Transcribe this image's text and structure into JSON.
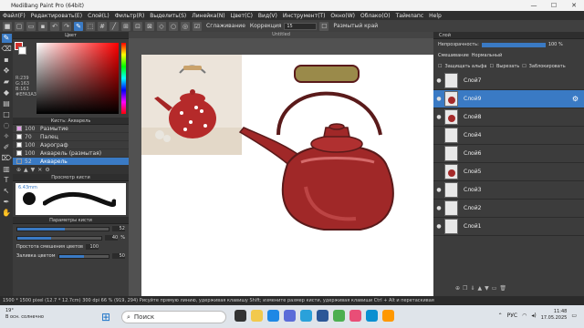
{
  "app": {
    "title": "MediBang Paint Pro (64bit)",
    "doc_title": "Untitled"
  },
  "window": {
    "minimize": "—",
    "maximize": "☐",
    "close": "✕"
  },
  "menu": [
    "Файл(F)",
    "Редактировать(E)",
    "Слой(L)",
    "Фильтр(R)",
    "Выделить(S)",
    "Линейка(N)",
    "Цвет(C)",
    "Вид(V)",
    "Инструмент(T)",
    "Окно(W)",
    "Облако(O)",
    "Таймлапс",
    "Help"
  ],
  "toolbar": {
    "smoothing_label": "Сглаживание",
    "correction_label": "Коррекция",
    "correction_value": "15",
    "mode_label": "Размытый край"
  },
  "color_panel": {
    "title": "Цвет",
    "values": [
      "R:239",
      "G:163",
      "B:163",
      "#EFA3A3"
    ],
    "fg": "#d4302b",
    "bg": "#ffffff"
  },
  "brush_panel": {
    "title": "Кисть: Акварель",
    "items": [
      {
        "size": "100",
        "name": "Размытие",
        "color": "#e29ee9"
      },
      {
        "size": "70",
        "name": "Палец",
        "color": "#ffffff"
      },
      {
        "size": "100",
        "name": "Аэрограф",
        "color": "#ffffff"
      },
      {
        "size": "100",
        "name": "Акварель (размытая)",
        "color": "#ffffff"
      },
      {
        "size": "52",
        "name": "Акварель",
        "color": "#3a7ac4"
      }
    ],
    "selected": 4
  },
  "brush_preview": {
    "title": "Просмотр кисти",
    "size": "6.43mm"
  },
  "brush_params": {
    "title": "Параметры кисти",
    "size": 52,
    "opacity": 40,
    "opacity_unit": "%",
    "mixing_label": "Простота смешения цветов",
    "mixing": 100,
    "fill_label": "Заливка цветом",
    "fill": 50
  },
  "layer_panel": {
    "title": "Слой",
    "opacity_label": "Непрозрачность:",
    "opacity_value": "100 %",
    "blend_label": "Смешивание",
    "blend_value": "Нормальный",
    "protect_alpha": "Защищать альфа",
    "clip": "Вырезать",
    "lock": "Заблокировать",
    "layers": [
      {
        "name": "Слой7"
      },
      {
        "name": "Слой9"
      },
      {
        "name": "Слой8"
      },
      {
        "name": "Слой4"
      },
      {
        "name": "Слой6"
      },
      {
        "name": "Слой5"
      },
      {
        "name": "Слой3"
      },
      {
        "name": "Слой2"
      },
      {
        "name": "Слой1"
      }
    ],
    "selected": 1
  },
  "status": "1500 * 1500 pixel  (12.7 * 12.7cm)  300 dpi  66 %  (919, 294)  Рисуйте прямую линию, удерживая клавишу Shift; измените размер кисти, удерживая клавиши Ctrl + Alt и перетаскивая",
  "taskbar": {
    "weather_temp": "19°",
    "weather_desc": "В осн. солнечно",
    "search": "Поиск",
    "lang": "РУС",
    "time": "11:48",
    "date": "17.05.2025"
  }
}
